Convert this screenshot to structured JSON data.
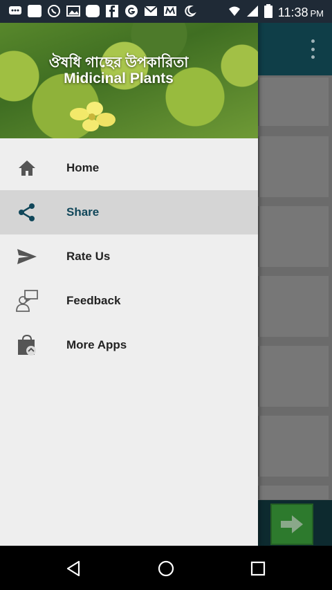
{
  "status_bar": {
    "time": "11:38",
    "ampm": "PM",
    "left_icons": [
      "messages-icon",
      "paytm-icon",
      "whatsapp-icon",
      "gallery-icon",
      "app-icon",
      "facebook-icon",
      "google-icon",
      "gmail-icon",
      "app-m-icon",
      "do-not-disturb-icon"
    ],
    "right_icons": [
      "wifi-icon",
      "signal-icon",
      "battery-icon"
    ]
  },
  "drawer": {
    "header": {
      "title_bn": "ঔষধি গাছের উপকারিতা",
      "title_en": "Midicinal Plants"
    },
    "items": [
      {
        "label": "Home",
        "icon": "home-icon",
        "active": false
      },
      {
        "label": "Share",
        "icon": "share-icon",
        "active": true
      },
      {
        "label": "Rate Us",
        "icon": "send-icon",
        "active": false
      },
      {
        "label": "Feedback",
        "icon": "feedback-icon",
        "active": false
      },
      {
        "label": "More Apps",
        "icon": "store-bag-icon",
        "active": false
      }
    ]
  },
  "colors": {
    "toolbar": "#0f3e48",
    "active_item": "#d5d5d5",
    "active_text": "#11475a",
    "next_button": "#2d7a2d"
  },
  "nav_bar": {
    "icons": [
      "back-icon",
      "home-circle-icon",
      "recents-icon"
    ]
  }
}
